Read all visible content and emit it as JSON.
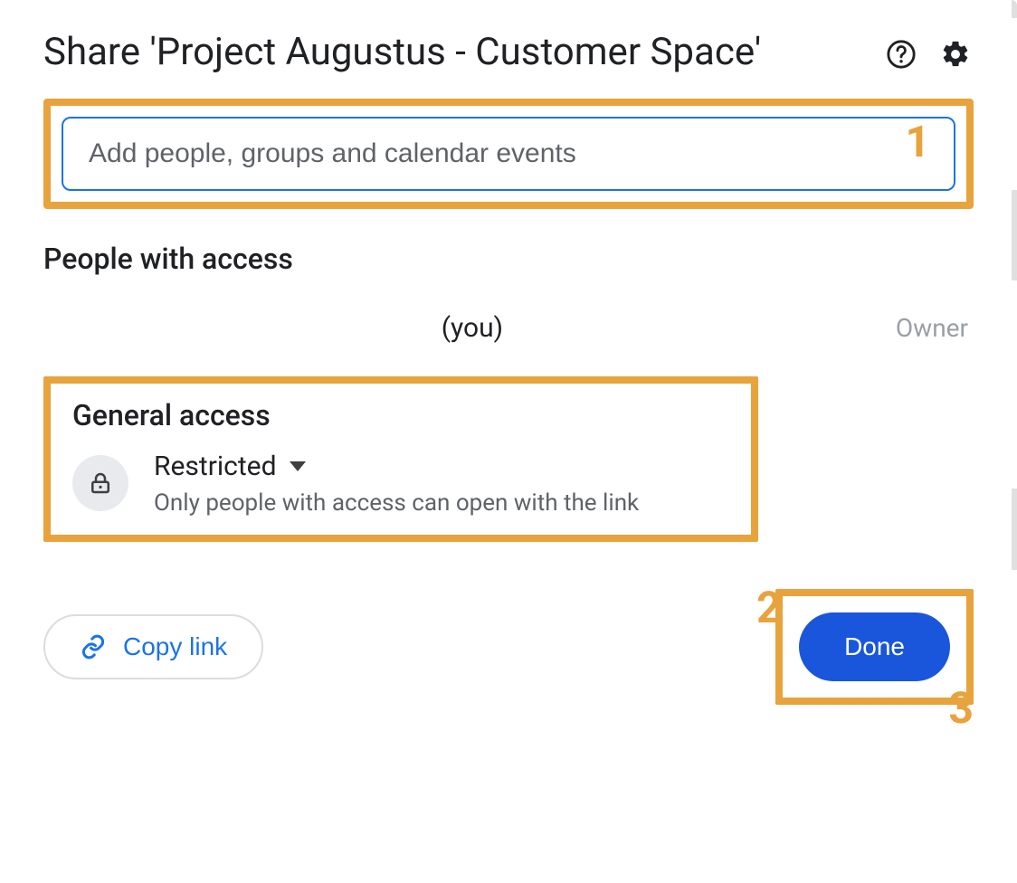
{
  "dialog": {
    "title": "Share 'Project Augustus - Customer Space'"
  },
  "input": {
    "placeholder": "Add people, groups and calendar events",
    "value": ""
  },
  "sections": {
    "people_heading": "People with access",
    "general_heading": "General access"
  },
  "people": {
    "you_label": "(you)",
    "role": "Owner"
  },
  "general_access": {
    "mode": "Restricted",
    "description": "Only people with access can open with the link"
  },
  "buttons": {
    "copy_link": "Copy link",
    "done": "Done"
  },
  "annotations": {
    "one": "1",
    "two": "2",
    "three": "3"
  }
}
